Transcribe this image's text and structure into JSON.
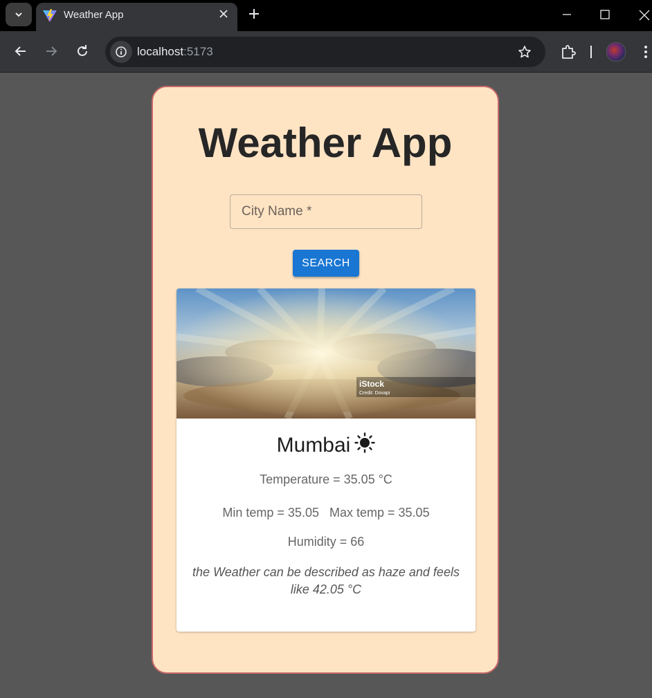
{
  "browser": {
    "tab_title": "Weather App",
    "url_host": "localhost",
    "url_port": ":5173"
  },
  "app": {
    "title": "Weather App",
    "input_placeholder": "City Name *",
    "search_label": "SEARCH"
  },
  "weather": {
    "image_watermark": "iStock",
    "image_credit": "Credit: Dovapi",
    "city": "Mumbai",
    "condition_icon": "sun-icon",
    "temperature": "Temperature = 35.05 °C",
    "min_temp": "Min temp = 35.05",
    "max_temp": "Max temp = 35.05",
    "humidity": "Humidity = 66",
    "description": "the Weather can be described as haze and feels like 42.05 °C"
  }
}
